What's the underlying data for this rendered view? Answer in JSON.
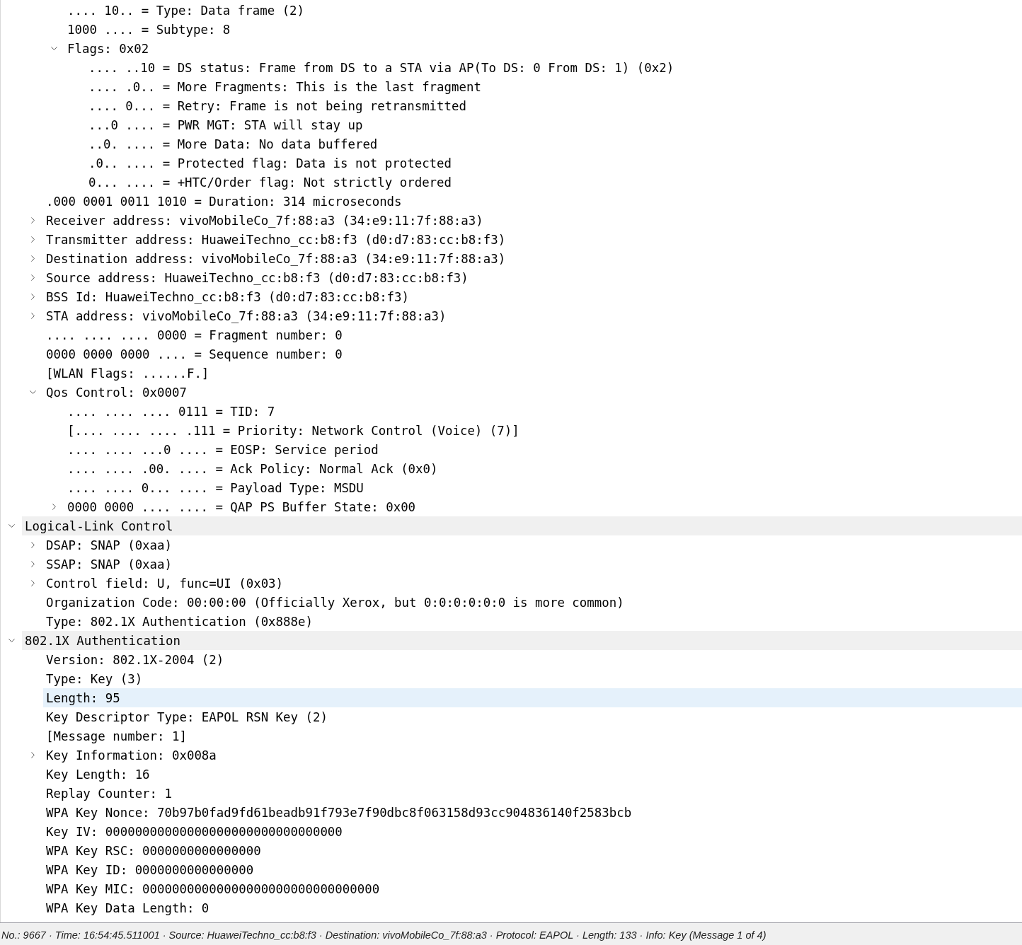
{
  "tree": [
    {
      "children": [
        {
          "children": [
            {
              "label": ".... 10.. = Type: Data frame (2)",
              "selected": false
            },
            {
              "label": "1000 .... = Subtype: 8",
              "selected": false
            },
            {
              "label": "Flags: 0x02",
              "selected": false,
              "expanded": true,
              "children": [
                {
                  "label": ".... ..10 = DS status: Frame from DS to a STA via AP(To DS: 0 From DS: 1) (0x2)",
                  "selected": false
                },
                {
                  "label": ".... .0.. = More Fragments: This is the last fragment",
                  "selected": false
                },
                {
                  "label": ".... 0... = Retry: Frame is not being retransmitted",
                  "selected": false
                },
                {
                  "label": "...0 .... = PWR MGT: STA will stay up",
                  "selected": false
                },
                {
                  "label": "..0. .... = More Data: No data buffered",
                  "selected": false
                },
                {
                  "label": ".0.. .... = Protected flag: Data is not protected",
                  "selected": false
                },
                {
                  "label": "0... .... = +HTC/Order flag: Not strictly ordered",
                  "selected": false
                }
              ]
            }
          ]
        },
        {
          "label": ".000 0001 0011 1010 = Duration: 314 microseconds",
          "selected": false
        },
        {
          "label": "Receiver address: vivoMobileCo_7f:88:a3 (34:e9:11:7f:88:a3)",
          "selected": false,
          "expanded": false
        },
        {
          "label": "Transmitter address: HuaweiTechno_cc:b8:f3 (d0:d7:83:cc:b8:f3)",
          "selected": false,
          "expanded": false
        },
        {
          "label": "Destination address: vivoMobileCo_7f:88:a3 (34:e9:11:7f:88:a3)",
          "selected": false,
          "expanded": false
        },
        {
          "label": "Source address: HuaweiTechno_cc:b8:f3 (d0:d7:83:cc:b8:f3)",
          "selected": false,
          "expanded": false
        },
        {
          "label": "BSS Id: HuaweiTechno_cc:b8:f3 (d0:d7:83:cc:b8:f3)",
          "selected": false,
          "expanded": false
        },
        {
          "label": "STA address: vivoMobileCo_7f:88:a3 (34:e9:11:7f:88:a3)",
          "selected": false,
          "expanded": false
        },
        {
          "label": ".... .... .... 0000 = Fragment number: 0",
          "selected": false
        },
        {
          "label": "0000 0000 0000 .... = Sequence number: 0",
          "selected": false
        },
        {
          "label": "[WLAN Flags: ......F.]",
          "selected": false
        },
        {
          "label": "Qos Control: 0x0007",
          "selected": false,
          "expanded": true,
          "children": [
            {
              "label": ".... .... .... 0111 = TID: 7",
              "selected": false
            },
            {
              "label": "[.... .... .... .111 = Priority: Network Control (Voice) (7)]",
              "selected": false
            },
            {
              "label": ".... .... ...0 .... = EOSP: Service period",
              "selected": false
            },
            {
              "label": ".... .... .00. .... = Ack Policy: Normal Ack (0x0)",
              "selected": false
            },
            {
              "label": ".... .... 0... .... = Payload Type: MSDU",
              "selected": false
            },
            {
              "label": "0000 0000 .... .... = QAP PS Buffer State: 0x00",
              "selected": false,
              "expanded": false
            }
          ]
        }
      ]
    },
    {
      "label": "Logical-Link Control",
      "selected": false,
      "expanded": true,
      "children": [
        {
          "label": "DSAP: SNAP (0xaa)",
          "selected": false,
          "expanded": false
        },
        {
          "label": "SSAP: SNAP (0xaa)",
          "selected": false,
          "expanded": false
        },
        {
          "label": "Control field: U, func=UI (0x03)",
          "selected": false,
          "expanded": false
        },
        {
          "label": "Organization Code: 00:00:00 (Officially Xerox, but 0:0:0:0:0:0 is more common)",
          "selected": false
        },
        {
          "label": "Type: 802.1X Authentication (0x888e)",
          "selected": false
        }
      ]
    },
    {
      "label": "802.1X Authentication",
      "selected": false,
      "expanded": true,
      "children": [
        {
          "label": "Version: 802.1X-2004 (2)",
          "selected": false
        },
        {
          "label": "Type: Key (3)",
          "selected": false
        },
        {
          "label": "Length: 95",
          "selected": true
        },
        {
          "label": "Key Descriptor Type: EAPOL RSN Key (2)",
          "selected": false
        },
        {
          "label": "[Message number: 1]",
          "selected": false
        },
        {
          "label": "Key Information: 0x008a",
          "selected": false,
          "expanded": false
        },
        {
          "label": "Key Length: 16",
          "selected": false
        },
        {
          "label": "Replay Counter: 1",
          "selected": false
        },
        {
          "label": "WPA Key Nonce: 70b97b0fad9fd61beadb91f793e7f90dbc8f063158d93cc904836140f2583bcb",
          "selected": false
        },
        {
          "label": "Key IV: 00000000000000000000000000000000",
          "selected": false
        },
        {
          "label": "WPA Key RSC: 0000000000000000",
          "selected": false
        },
        {
          "label": "WPA Key ID: 0000000000000000",
          "selected": false
        },
        {
          "label": "WPA Key MIC: 00000000000000000000000000000000",
          "selected": false
        },
        {
          "label": "WPA Key Data Length: 0",
          "selected": false
        }
      ]
    }
  ],
  "status_bar": "No.: 9667 · Time: 16:54:45.511001 · Source: HuaweiTechno_cc:b8:f3 · Destination: vivoMobileCo_7f:88:a3 · Protocol: EAPOL · Length: 133 · Info: Key (Message 1 of 4)"
}
